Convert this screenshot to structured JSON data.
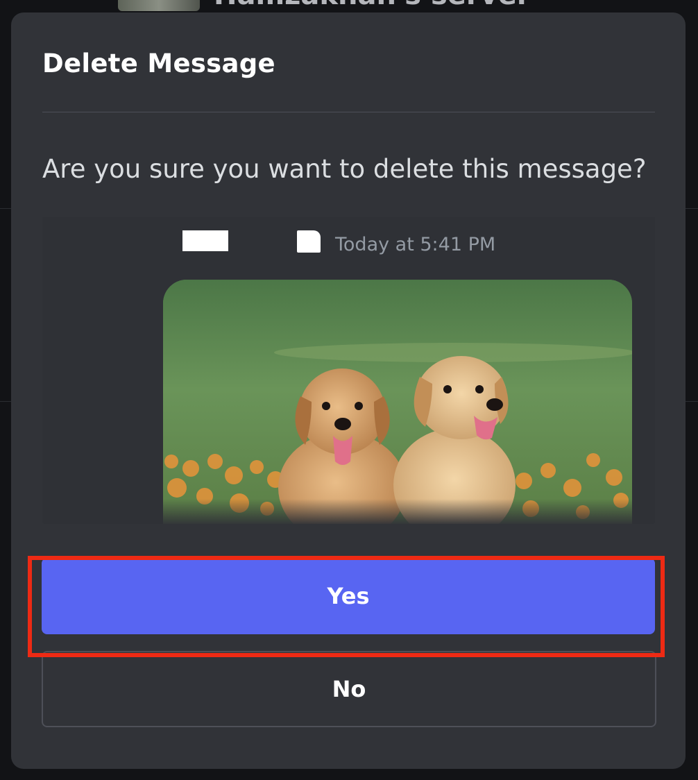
{
  "background": {
    "server_name": "Hamzakhan's server"
  },
  "dialog": {
    "title": "Delete Message",
    "question": "Are you sure you want to delete this message?",
    "message_preview": {
      "timestamp": "Today at 5:41 PM",
      "attachment_icon": "puppies-photo-icon"
    },
    "buttons": {
      "confirm_label": "Yes",
      "cancel_label": "No"
    },
    "highlight_target": "confirm-button"
  },
  "colors": {
    "modal_bg": "#313338",
    "confirm_bg": "#5865f2",
    "highlight_border": "#ee2a14",
    "timestamp_text": "#949ba4"
  }
}
